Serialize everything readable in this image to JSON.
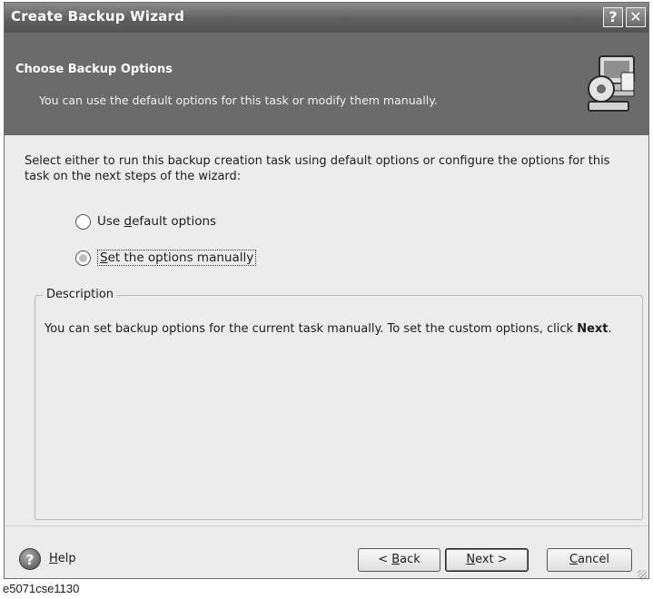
{
  "window": {
    "title": "Create Backup Wizard",
    "help_glyph": "?",
    "close_glyph": "✕"
  },
  "header": {
    "title": "Choose Backup Options",
    "subtitle": "You can use the default options for this task or modify them manually.",
    "icon": "computer-settings-icon"
  },
  "content": {
    "intro": "Select either to run this backup creation task using default options or configure the options for this task on the next steps of the wizard:",
    "options": [
      {
        "pre": "Use ",
        "accel": "d",
        "post": "efault options",
        "checked": false
      },
      {
        "pre": "",
        "accel": "S",
        "post": "et the options manually",
        "checked": true
      }
    ],
    "description": {
      "legend": "Description",
      "text": "You can set backup options for the current task manually. To set the custom options, click ",
      "bold": "Next",
      "after": "."
    }
  },
  "footer": {
    "help": {
      "accel": "H",
      "post": "elp",
      "icon_glyph": "?"
    },
    "back": {
      "pre": "< ",
      "accel": "B",
      "post": "ack"
    },
    "next": {
      "pre": "",
      "accel": "N",
      "post": "ext >"
    },
    "cancel": {
      "pre": "",
      "accel": "C",
      "post": "ancel"
    }
  },
  "caption": "e5071cse1130"
}
